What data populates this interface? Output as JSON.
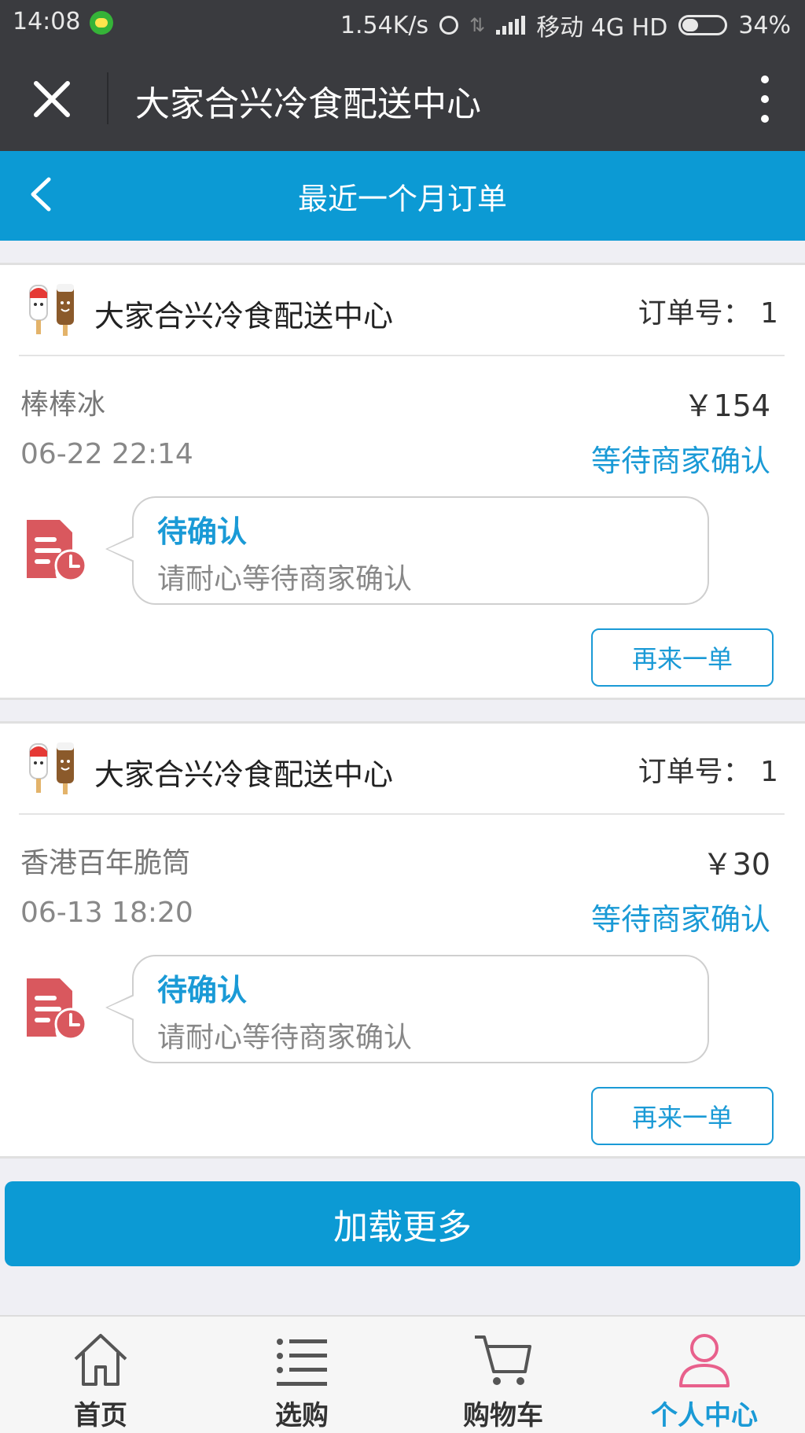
{
  "status_bar": {
    "time": "14:08",
    "speed": "1.54K/s",
    "carrier": "移动 4G HD",
    "battery": "34%"
  },
  "wechat_bar": {
    "title": "大家合兴冷食配送中心"
  },
  "nav": {
    "title": "最近一个月订单"
  },
  "orders": [
    {
      "shop": "大家合兴冷食配送中心",
      "order_no_label": "订单号：",
      "order_no": "1",
      "product": "棒棒冰",
      "price": "￥154",
      "date": "06-22 22:14",
      "status": "等待商家确认",
      "timeline_title": "待确认",
      "timeline_desc": "请耐心等待商家确认",
      "reorder_label": "再来一单"
    },
    {
      "shop": "大家合兴冷食配送中心",
      "order_no_label": "订单号：",
      "order_no": "1",
      "product": "香港百年脆筒",
      "price": "￥30",
      "date": "06-13 18:20",
      "status": "等待商家确认",
      "timeline_title": "待确认",
      "timeline_desc": "请耐心等待商家确认",
      "reorder_label": "再来一单"
    }
  ],
  "load_more": "加载更多",
  "tabs": [
    {
      "label": "首页",
      "icon": "home-icon"
    },
    {
      "label": "选购",
      "icon": "list-icon"
    },
    {
      "label": "购物车",
      "icon": "cart-icon"
    },
    {
      "label": "个人中心",
      "icon": "person-icon",
      "active": true
    }
  ],
  "colors": {
    "accent": "#0c9ad4",
    "header_dark": "#3a3b3f",
    "order_icon": "#d9585e",
    "active_tab_icon": "#e8608c"
  }
}
